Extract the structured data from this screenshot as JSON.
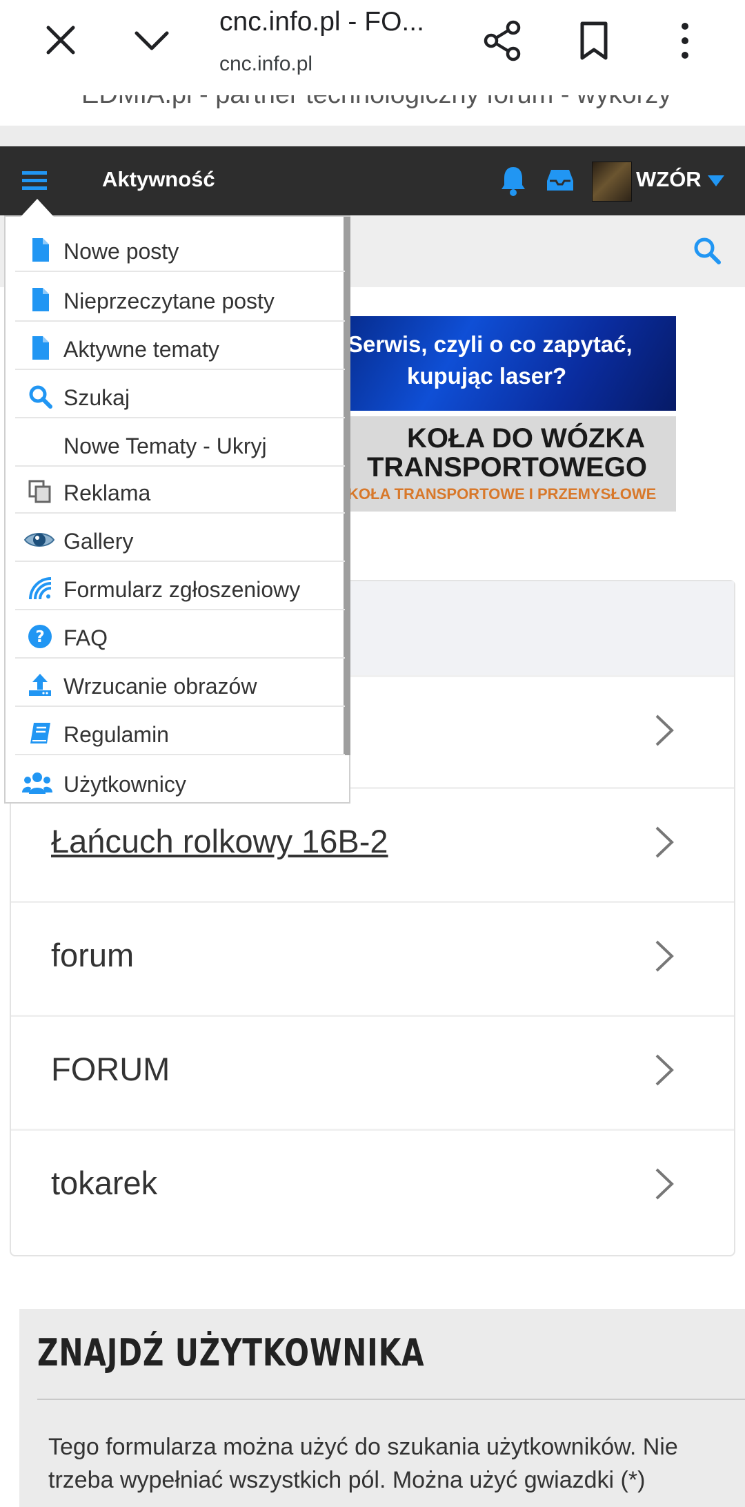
{
  "browser": {
    "tab_title": "cnc.info.pl - FO...",
    "url": "cnc.info.pl",
    "ticker_text": "EDMIA.pl - partner technologiczny forum - wykorzy"
  },
  "navbar": {
    "title": "Aktywność",
    "username": "WZÓR"
  },
  "colors": {
    "accent": "#2196f3",
    "navbar_bg": "#2d2d2d"
  },
  "banners": {
    "laser_line1": "Serwis, czyli o co zapytać,",
    "laser_line2": "kupując laser?",
    "wheels_line1": "KOŁA DO WÓZKA",
    "wheels_line2": "TRANSPORTOWEGO",
    "wheels_line3": "KOŁA TRANSPORTOWE I PRZEMYSŁOWE"
  },
  "tags": [
    {
      "label": "Łańcuch rolkowy 16B-2"
    },
    {
      "label": "forum"
    },
    {
      "label": "FORUM"
    },
    {
      "label": "tokarek"
    }
  ],
  "find_user": {
    "heading": "ZNAJDŹ UŻYTKOWNIKA",
    "description": "Tego formularza można użyć do szukania użytkowników. Nie trzeba wypełniać wszystkich pól. Można użyć gwiazdki (*)"
  },
  "menu": {
    "items": [
      {
        "label": "Nowe posty",
        "icon": "file-icon"
      },
      {
        "label": "Nieprzeczytane posty",
        "icon": "file-icon"
      },
      {
        "label": "Aktywne tematy",
        "icon": "file-icon"
      },
      {
        "label": "Szukaj",
        "icon": "search-icon"
      },
      {
        "label": "Nowe Tematy - Ukryj",
        "icon": ""
      },
      {
        "label": "Reklama",
        "icon": "copy-icon"
      },
      {
        "label": "Gallery",
        "icon": "eye-icon"
      },
      {
        "label": "Formularz zgłoszeniowy",
        "icon": "wifi-icon"
      },
      {
        "label": "FAQ",
        "icon": "question-circle-icon"
      },
      {
        "label": "Wrzucanie obrazów",
        "icon": "upload-icon"
      },
      {
        "label": "Regulamin",
        "icon": "book-icon"
      },
      {
        "label": "Użytkownicy",
        "icon": "users-icon"
      }
    ]
  }
}
